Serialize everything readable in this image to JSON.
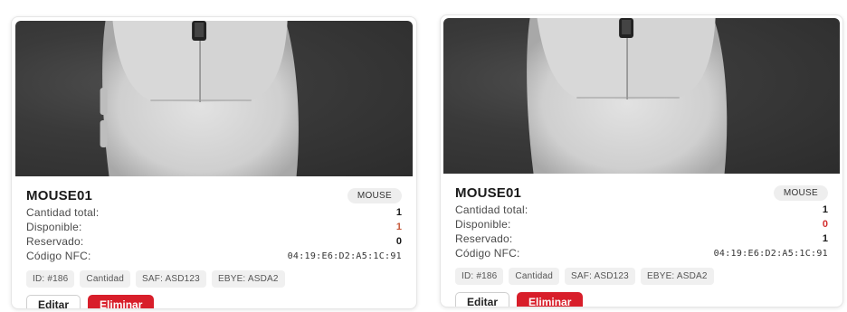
{
  "cards": [
    {
      "name": "MOUSE01",
      "category": "MOUSE",
      "stats": [
        {
          "label": "Cantidad total:",
          "value": "1"
        },
        {
          "label": "Disponible:",
          "value": "1"
        },
        {
          "label": "Reservado:",
          "value": "0"
        },
        {
          "label": "Código NFC:",
          "value": "04:19:E6:D2:A5:1C:91"
        }
      ],
      "tags": [
        "ID: #186",
        "Cantidad",
        "SAF: ASD123",
        "EBYE: ASDA2"
      ],
      "edit_label": "Editar",
      "delete_label": "Eliminar",
      "available_color": "#c65a3b"
    },
    {
      "name": "MOUSE01",
      "category": "MOUSE",
      "stats": [
        {
          "label": "Cantidad total:",
          "value": "1"
        },
        {
          "label": "Disponible:",
          "value": "0"
        },
        {
          "label": "Reservado:",
          "value": "1"
        },
        {
          "label": "Código NFC:",
          "value": "04:19:E6:D2:A5:1C:91"
        }
      ],
      "tags": [
        "ID: #186",
        "Cantidad",
        "SAF: ASD123",
        "EBYE: ASDA2"
      ],
      "edit_label": "Editar",
      "delete_label": "Eliminar",
      "available_color": "#d32f2f"
    }
  ],
  "colors": {
    "delete_button": "#d81e2a",
    "badge_bg": "#eeeeee",
    "chip_bg": "#f0f0f0"
  }
}
